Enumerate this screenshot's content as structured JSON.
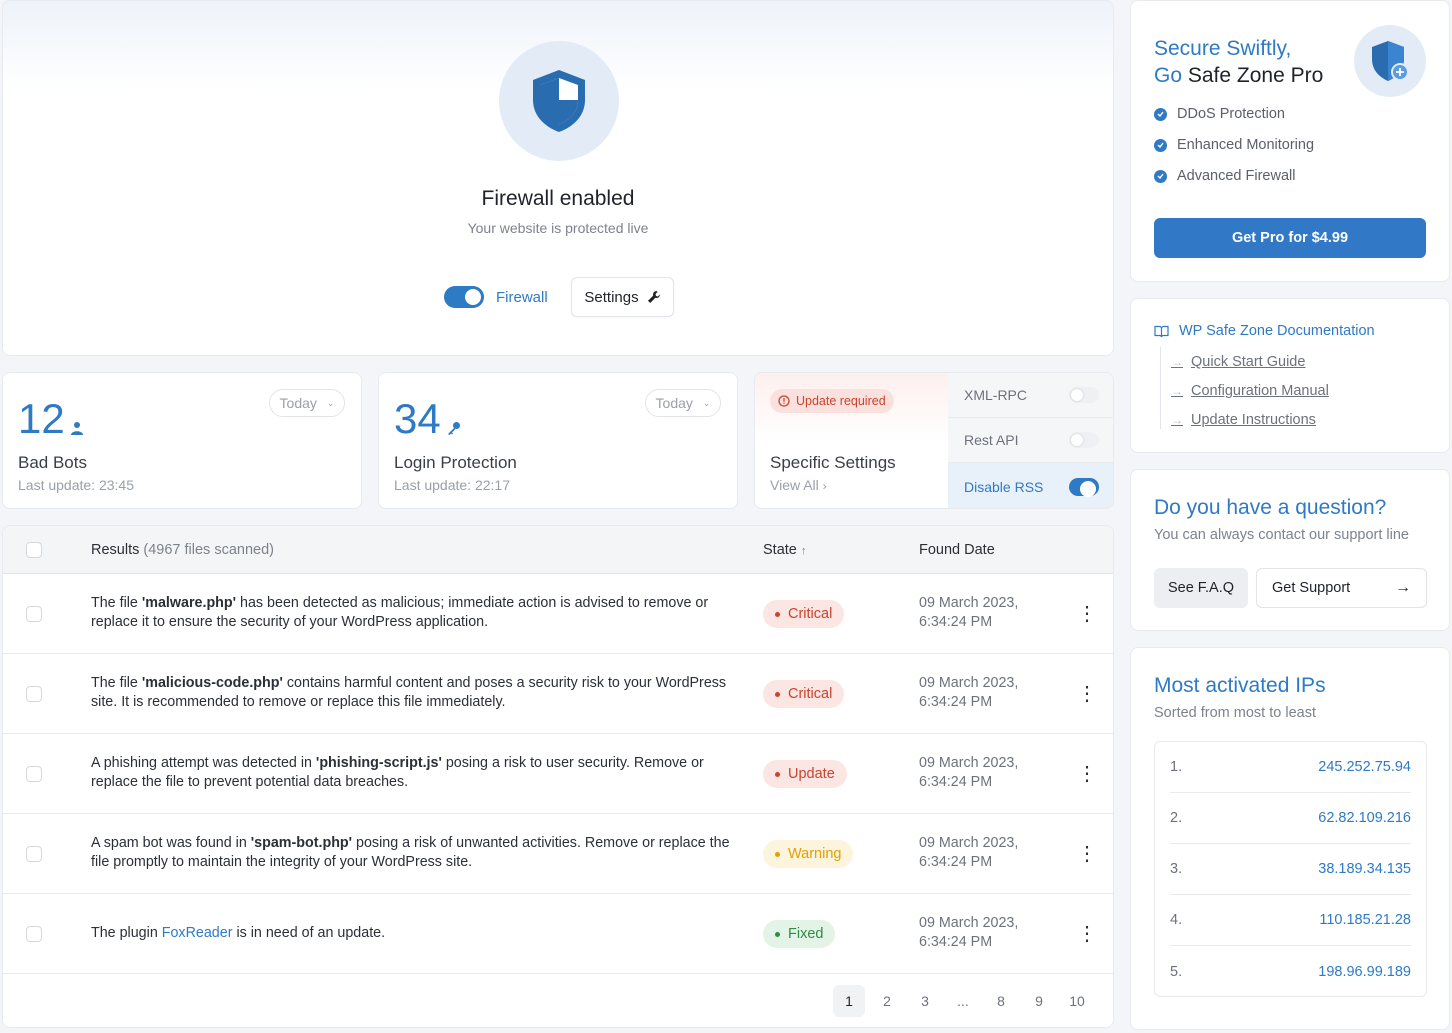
{
  "hero": {
    "title": "Firewall enabled",
    "subtitle": "Your website is protected live",
    "toggle_label": "Firewall",
    "settings_label": "Settings"
  },
  "stats": [
    {
      "value": "12",
      "label": "Bad Bots",
      "updated": "Last update: 23:45",
      "period": "Today",
      "icon": "user-icon"
    },
    {
      "value": "34",
      "label": "Login Protection",
      "updated": "Last update: 22:17",
      "period": "Today",
      "icon": "key-icon"
    }
  ],
  "specific": {
    "badge": "Update required",
    "title": "Specific Settings",
    "view_all": "View All",
    "options": [
      {
        "label": "XML-RPC",
        "on": false
      },
      {
        "label": "Rest API",
        "on": false
      },
      {
        "label": "Disable RSS",
        "on": true
      }
    ]
  },
  "table": {
    "header_results": "Results",
    "header_count": "(4967 files scanned)",
    "header_state": "State",
    "header_date": "Found Date",
    "rows": [
      {
        "pre": "The file ",
        "file": "'malware.php'",
        "post": " has been detected as malicious; immediate action is advised to remove or replace it to ensure the security of your WordPress application.",
        "state": "Critical",
        "state_kind": "critical",
        "date1": "09 March 2023,",
        "date2": "6:34:24 PM"
      },
      {
        "pre": "The file ",
        "file": "'malicious-code.php'",
        "post": " contains harmful content and poses a security risk to your WordPress site. It is recommended to remove or replace this file immediately.",
        "state": "Critical",
        "state_kind": "critical",
        "date1": "09 March 2023,",
        "date2": "6:34:24 PM"
      },
      {
        "pre": "A phishing attempt was detected in ",
        "file": "'phishing-script.js'",
        "post": " posing a risk to user security. Remove or replace the file to prevent potential data breaches.",
        "state": "Update",
        "state_kind": "update",
        "date1": "09 March 2023,",
        "date2": "6:34:24 PM"
      },
      {
        "pre": "A spam bot was found in ",
        "file": "'spam-bot.php'",
        "post": " posing a risk of unwanted activities. Remove or replace the file promptly to maintain the integrity of your WordPress site.",
        "state": "Warning",
        "state_kind": "warning",
        "date1": "09 March 2023,",
        "date2": "6:34:24 PM"
      },
      {
        "pre": "The plugin ",
        "link": "FoxReader",
        "post": " is in need of an update.",
        "state": "Fixed",
        "state_kind": "fixed",
        "date1": "09 March 2023,",
        "date2": "6:34:24 PM"
      }
    ],
    "pages": [
      "1",
      "2",
      "3",
      "...",
      "8",
      "9",
      "10"
    ],
    "current_page": "1"
  },
  "pro": {
    "title_line1": "Secure Swiftly,",
    "title_go": "Go ",
    "title_brand": "Safe Zone Pro",
    "features": [
      "DDoS Protection",
      "Enhanced Monitoring",
      "Advanced Firewall"
    ],
    "button": "Get Pro for $4.99"
  },
  "docs": {
    "title": "WP Safe Zone Documentation",
    "links": [
      "Quick Start Guide",
      "Configuration Manual",
      "Update Instructions"
    ]
  },
  "question": {
    "title": "Do you have a question?",
    "subtitle": "You can always contact our support line",
    "faq_button": "See F.A.Q",
    "support_button": "Get Support"
  },
  "ips": {
    "title": "Most activated IPs",
    "subtitle": "Sorted from most to least",
    "list": [
      {
        "rank": "1.",
        "ip": "245.252.75.94"
      },
      {
        "rank": "2.",
        "ip": "62.82.109.216"
      },
      {
        "rank": "3.",
        "ip": "38.189.34.135"
      },
      {
        "rank": "4.",
        "ip": "110.185.21.28"
      },
      {
        "rank": "5.",
        "ip": "198.96.99.189"
      }
    ]
  },
  "colors": {
    "accent": "#2f7ac4",
    "critical": "#c8442f",
    "warning": "#e0a000",
    "fixed": "#2e8b45"
  }
}
